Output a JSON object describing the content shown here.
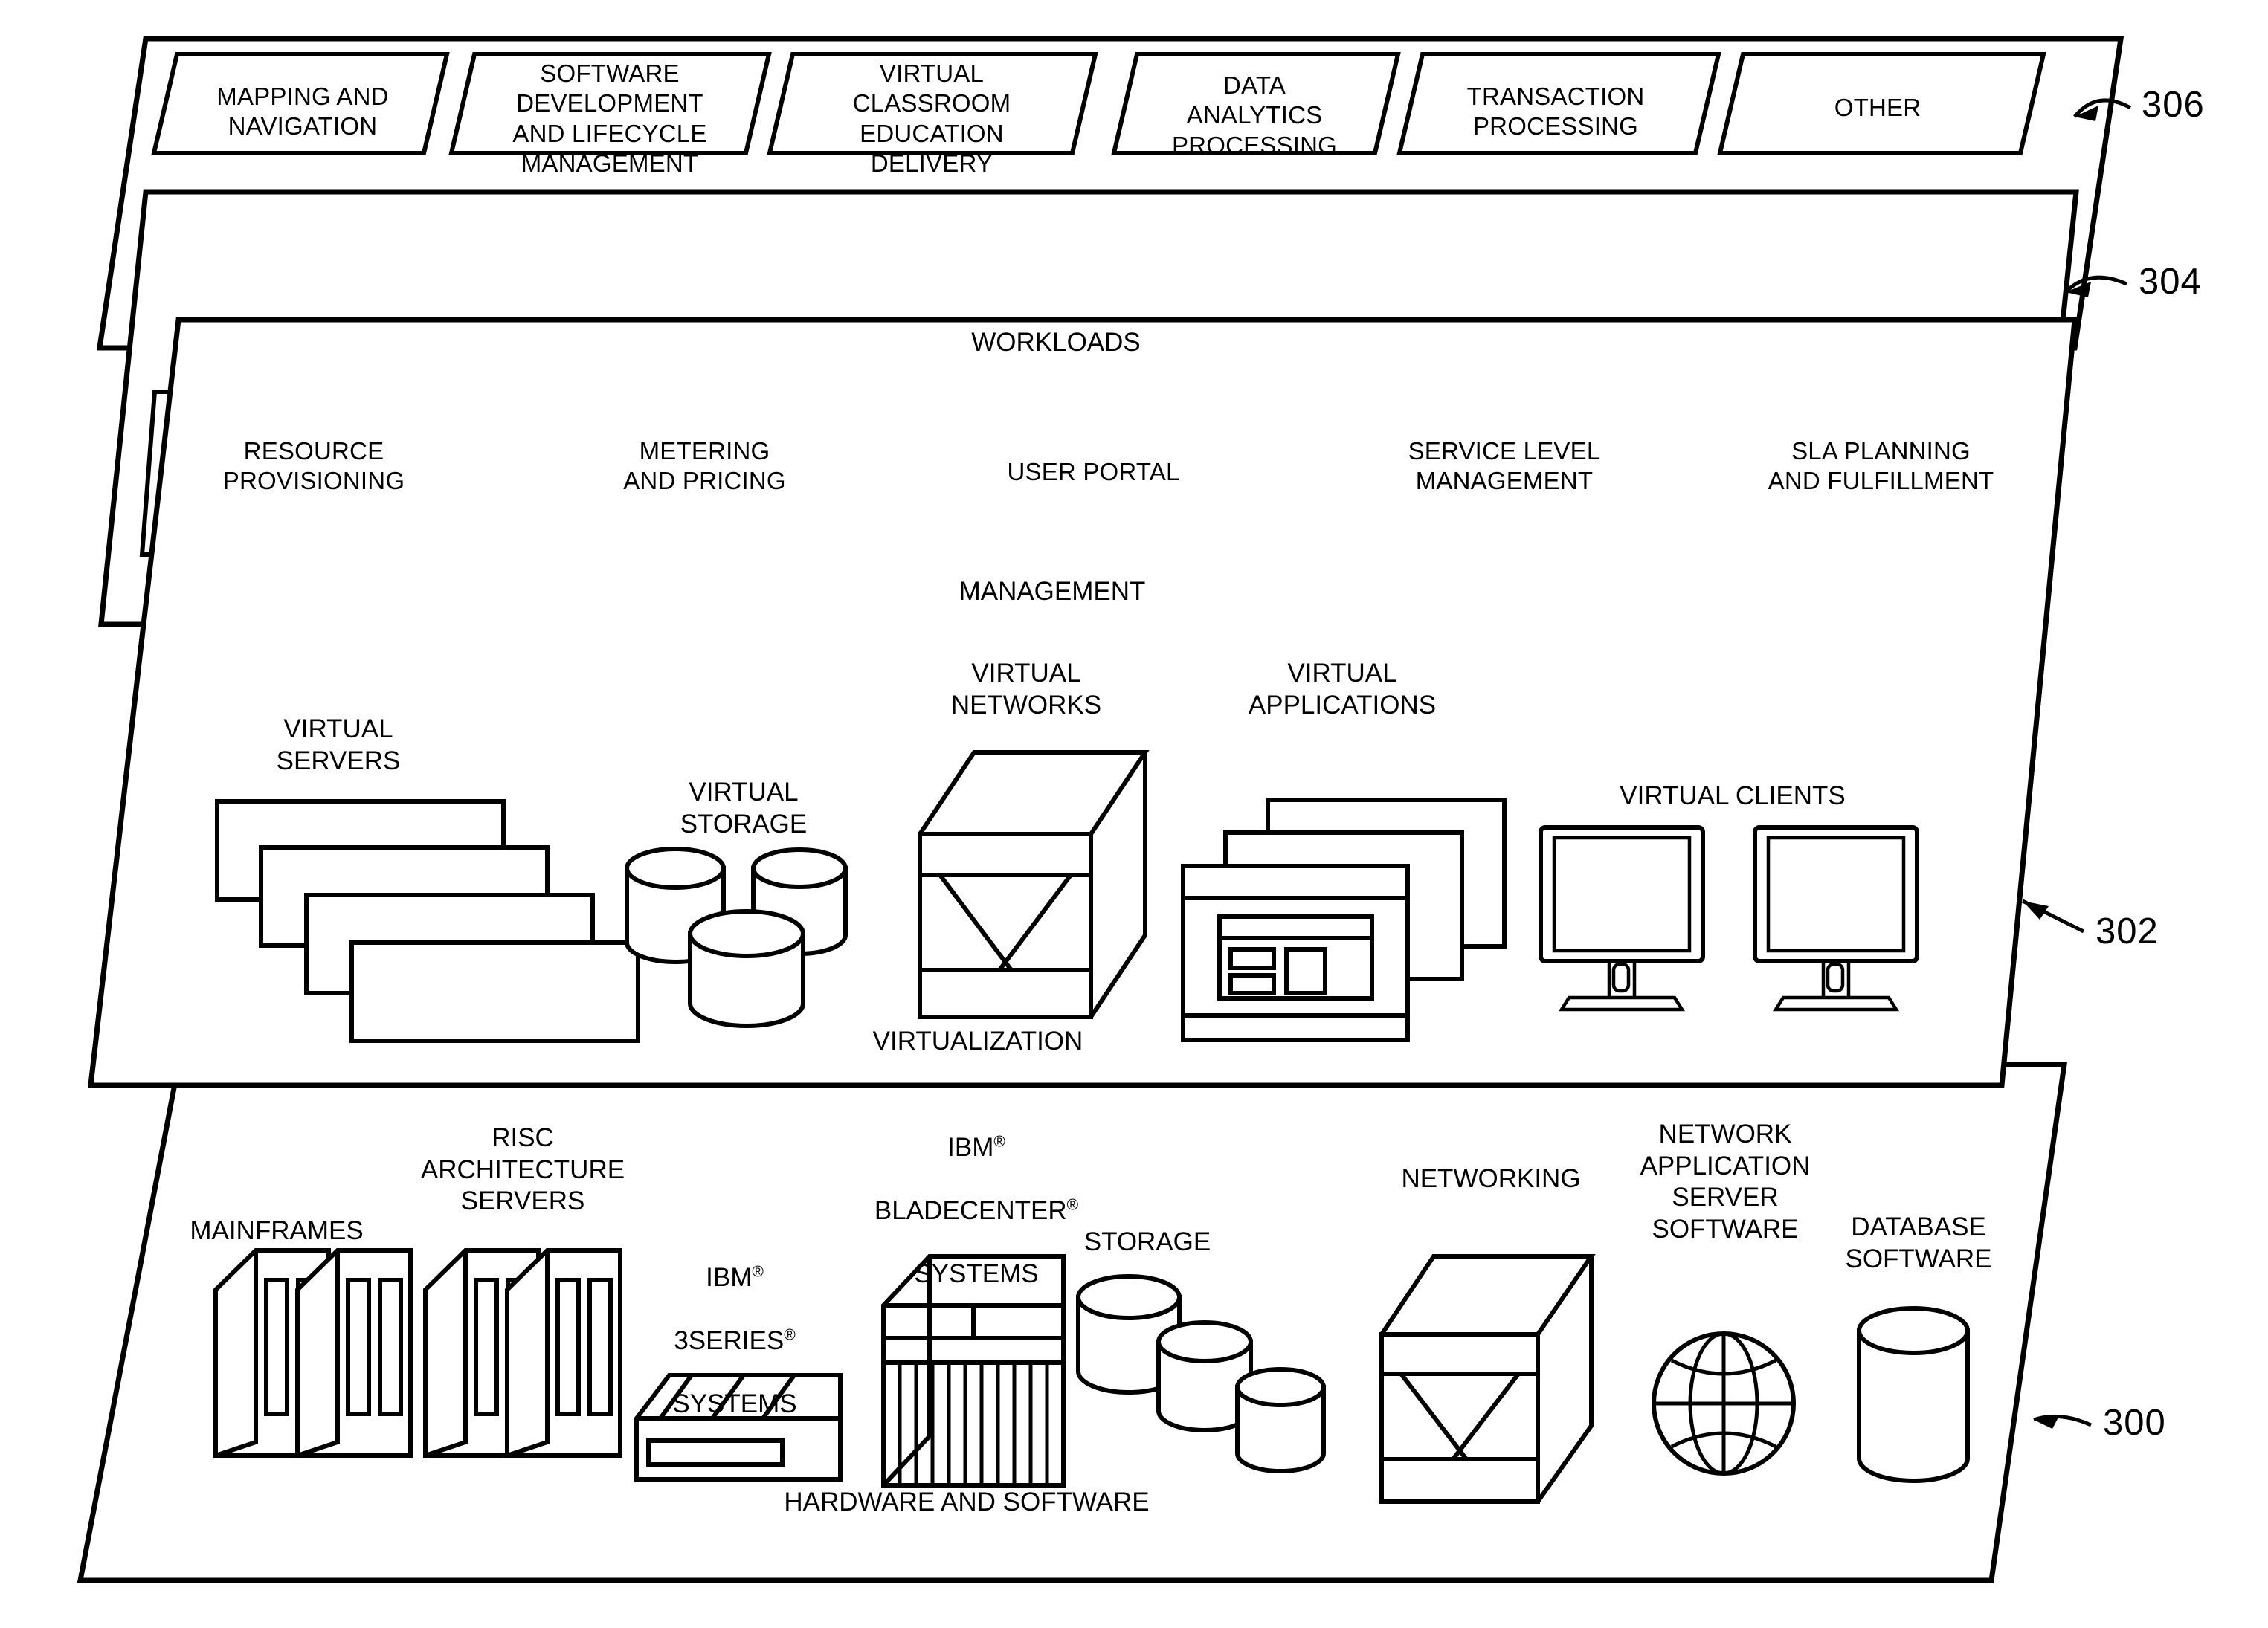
{
  "figure": {
    "type": "cloud-computing-abstraction-model-layers",
    "background_color": "#ffffff",
    "line_color": "#000000"
  },
  "layers": [
    {
      "id": "workloads",
      "ref": "306",
      "name": "WORKLOADS",
      "tiles": [
        {
          "label": "MAPPING AND\nNAVIGATION"
        },
        {
          "label": "SOFTWARE\nDEVELOPMENT\nAND LIFECYCLE\nMANAGEMENT"
        },
        {
          "label": "VIRTUAL\nCLASSROOM\nEDUCATION\nDELIVERY"
        },
        {
          "label": "DATA\nANALYTICS\nPROCESSING"
        },
        {
          "label": "TRANSACTION\nPROCESSING"
        },
        {
          "label": "OTHER"
        }
      ]
    },
    {
      "id": "management",
      "ref": "304",
      "name": "MANAGEMENT",
      "tiles": [
        {
          "label": "RESOURCE\nPROVISIONING"
        },
        {
          "label": "METERING\nAND PRICING"
        },
        {
          "label": "USER PORTAL"
        },
        {
          "label": "SERVICE LEVEL\nMANAGEMENT"
        },
        {
          "label": "SLA PLANNING\nAND FULFILLMENT"
        }
      ]
    },
    {
      "id": "virtualization",
      "ref": "302",
      "name": "VIRTUALIZATION",
      "items": [
        {
          "icon": "virtual-servers-icon",
          "label": "VIRTUAL\nSERVERS"
        },
        {
          "icon": "virtual-storage-icon",
          "label": "VIRTUAL\nSTORAGE"
        },
        {
          "icon": "virtual-networks-icon",
          "label": "VIRTUAL\nNETWORKS"
        },
        {
          "icon": "virtual-applications-icon",
          "label": "VIRTUAL\nAPPLICATIONS"
        },
        {
          "icon": "virtual-clients-icon",
          "label": "VIRTUAL CLIENTS"
        }
      ]
    },
    {
      "id": "hardware-and-software",
      "ref": "300",
      "name": "HARDWARE AND SOFTWARE",
      "items": [
        {
          "icon": "mainframes-icon",
          "label": "MAINFRAMES"
        },
        {
          "icon": "risc-servers-icon",
          "label": "RISC\nARCHITECTURE\nSERVERS"
        },
        {
          "icon": "ibm-3series-icon",
          "label_parts": [
            "IBM",
            "®",
            "3SERIES",
            "®",
            "SYSTEMS"
          ],
          "label": "IBM ®\n3SERIES ®\nSYSTEMS"
        },
        {
          "icon": "ibm-bladecenter-icon",
          "label_parts": [
            "IBM",
            "®",
            "BLADECENTER",
            "®",
            "SYSTEMS"
          ],
          "label": "IBM ®\nBLADECENTER ®\nSYSTEMS"
        },
        {
          "icon": "storage-icon",
          "label": "STORAGE"
        },
        {
          "icon": "networking-icon",
          "label": "NETWORKING"
        },
        {
          "icon": "network-application-server-software-icon",
          "label": "NETWORK\nAPPLICATION\nSERVER\nSOFTWARE"
        },
        {
          "icon": "database-software-icon",
          "label": "DATABASE\nSOFTWARE"
        }
      ]
    }
  ],
  "reference_numbers": [
    "306",
    "304",
    "302",
    "300"
  ],
  "registered_mark": "®"
}
